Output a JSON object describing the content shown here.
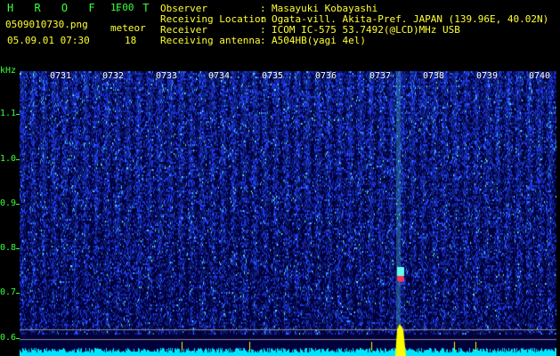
{
  "header": {
    "brand": "H R O F F T",
    "version": "1.00",
    "filename": "0509010730.png",
    "mode": "meteor",
    "datetime": "05.09.01 07:30",
    "count": "18"
  },
  "metadata": [
    {
      "label": "Observer",
      "value": "Masayuki Kobayashi"
    },
    {
      "label": "Receiving Location",
      "value": "Ogata-vill. Akita-Pref. JAPAN (139.96E, 40.02N)"
    },
    {
      "label": "Receiver",
      "value": "ICOM IC-575 53.7492(@LCD)MHz USB"
    },
    {
      "label": "Receiving antenna",
      "value": "A504HB(yagi 4el)"
    }
  ],
  "separator": ":",
  "axis": {
    "unit": "kHz",
    "y_ticks": [
      "1.1",
      "1.0",
      "0.9",
      "0.8",
      "0.7",
      "0.6"
    ],
    "x_ticks": [
      "0731",
      "0732",
      "0733",
      "0734",
      "0735",
      "0736",
      "0737",
      "0738",
      "0739",
      "0740"
    ]
  },
  "colors": {
    "background": "#000000",
    "noise": "#1a3cff",
    "highlight": "#ffff00",
    "detection": "#ff3355",
    "baseline": "#00e5ff"
  }
}
